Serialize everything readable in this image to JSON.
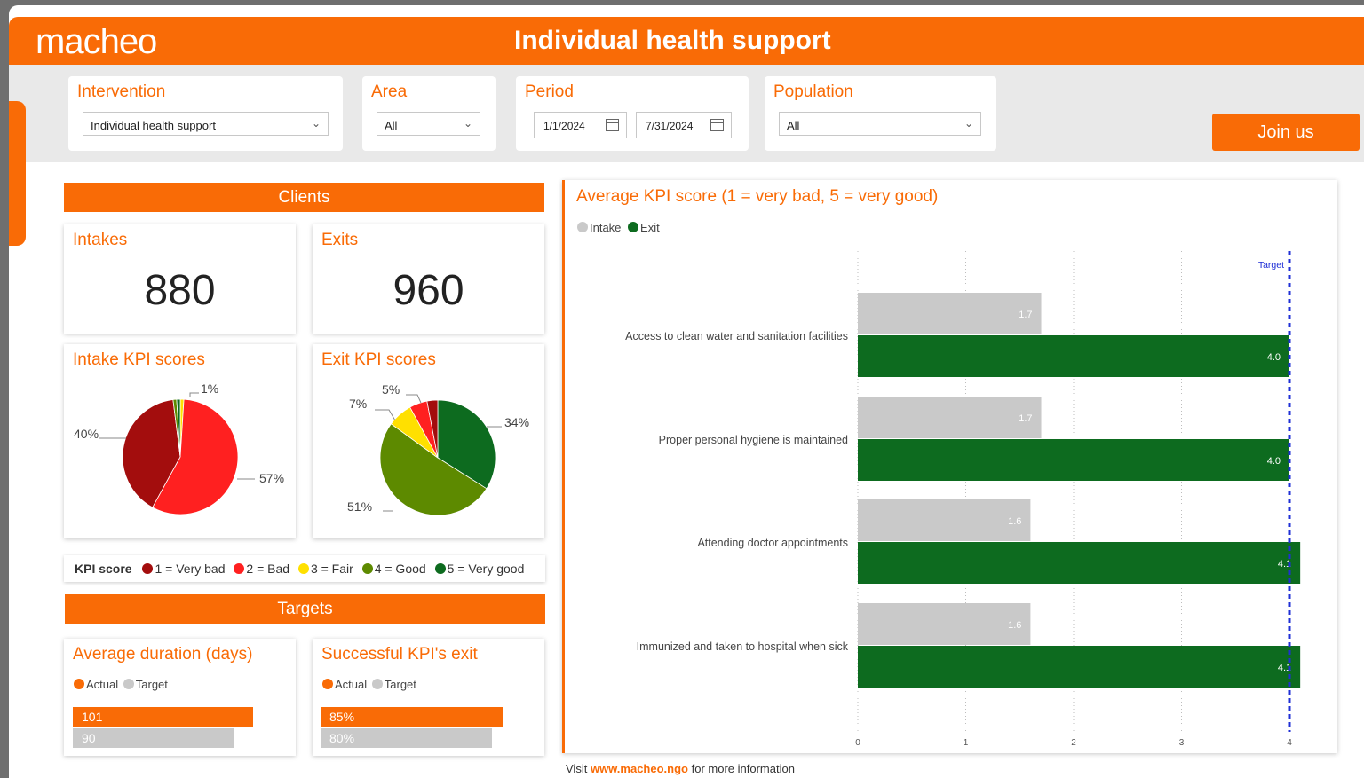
{
  "header": {
    "logo": "macheo",
    "title": "Individual health support"
  },
  "filters": {
    "intervention": {
      "label": "Intervention",
      "value": "Individual health support"
    },
    "area": {
      "label": "Area",
      "value": "All"
    },
    "period": {
      "label": "Period",
      "start": "1/1/2024",
      "end": "7/31/2024"
    },
    "population": {
      "label": "Population",
      "value": "All"
    }
  },
  "join_button": "Join us",
  "clients": {
    "section_title": "Clients",
    "intakes": {
      "label": "Intakes",
      "value": "880"
    },
    "exits": {
      "label": "Exits",
      "value": "960"
    }
  },
  "colors": {
    "very_bad": "#a30d0d",
    "bad": "#ff2020",
    "fair": "#ffe000",
    "good": "#5d8a00",
    "very_good": "#0d6b1f",
    "accent": "#f96b06",
    "intake_grey": "#c9c9c9",
    "target_blue": "#1f2fd6"
  },
  "intake_pie": {
    "title": "Intake KPI scores",
    "labels": {
      "very_bad": "40%",
      "bad": "57%",
      "fair": "1%"
    },
    "values": {
      "very_bad": 40,
      "bad": 57,
      "fair": 1,
      "good": 1,
      "very_good": 1
    }
  },
  "exit_pie": {
    "title": "Exit KPI scores",
    "labels": {
      "very_good": "34%",
      "good": "51%",
      "fair": "7%",
      "bad": "5%"
    },
    "values": {
      "very_bad": 3,
      "bad": 5,
      "fair": 7,
      "good": 51,
      "very_good": 34
    }
  },
  "kpi_legend": {
    "title": "KPI score",
    "items": [
      "1 = Very bad",
      "2 = Bad",
      "3 = Fair",
      "4 = Good",
      "5 = Very good"
    ]
  },
  "targets": {
    "section_title": "Targets",
    "avg_duration": {
      "title": "Average duration (days)",
      "actual_label": "Actual",
      "target_label": "Target",
      "actual": "101",
      "target": "90",
      "actual_fill": 0.87,
      "target_fill": 0.78
    },
    "successful_exit": {
      "title": "Successful KPI's exit",
      "actual_label": "Actual",
      "target_label": "Target",
      "actual": "85%",
      "target": "80%",
      "actual_fill": 0.88,
      "target_fill": 0.83
    }
  },
  "kpi_chart": {
    "title": "Average KPI score (1 = very bad, 5 = very good)",
    "legend": {
      "intake": "Intake",
      "exit": "Exit"
    },
    "target_label": "Target"
  },
  "chart_data": {
    "type": "bar",
    "orientation": "horizontal",
    "categories": [
      "Access to clean water and sanitation facilities",
      "Proper personal hygiene is maintained",
      "Attending doctor appointments",
      "Immunized and taken to hospital when sick"
    ],
    "series": [
      {
        "name": "Intake",
        "values": [
          1.7,
          1.7,
          1.6,
          1.6
        ],
        "labels": [
          "1.7",
          "1.7",
          "1.6",
          "1.6"
        ]
      },
      {
        "name": "Exit",
        "values": [
          4.0,
          4.0,
          4.1,
          4.1
        ],
        "labels": [
          "4.0",
          "4.0",
          "4.1",
          "4.1"
        ]
      }
    ],
    "target": 4,
    "xlim": [
      0,
      4.1
    ],
    "xticks": [
      "0",
      "1",
      "2",
      "3",
      "4"
    ],
    "grid": true,
    "legend": "top-left"
  },
  "footer": {
    "prefix": "Visit",
    "link": "www.macheo.ngo",
    "suffix": "for more information"
  }
}
